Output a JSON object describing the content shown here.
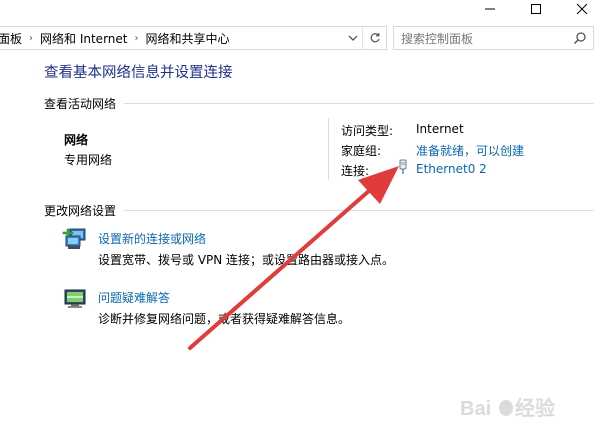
{
  "window": {
    "minimize_label": "—",
    "maximize_label": "☐",
    "close_label": "✕"
  },
  "breadcrumb": {
    "items": [
      "面板",
      "网络和 Internet",
      "网络和共享中心"
    ]
  },
  "search": {
    "placeholder": "搜索控制面板"
  },
  "main": {
    "title": "查看基本网络信息并设置连接",
    "active_networks_label": "查看活动网络",
    "network": {
      "name": "网络",
      "type": "专用网络"
    },
    "details": {
      "access_type_label": "访问类型:",
      "access_type_value": "Internet",
      "homegroup_label": "家庭组:",
      "homegroup_value": "准备就绪，可以创建",
      "connection_label": "连接:",
      "connection_value": "Ethernet0 2"
    },
    "change_settings_label": "更改网络设置",
    "tasks": [
      {
        "title": "设置新的连接或网络",
        "description": "设置宽带、拨号或 VPN 连接；或设置路由器或接入点。",
        "icon": "new-connection-icon"
      },
      {
        "title": "问题疑难解答",
        "description": "诊断并修复网络问题，或者获得疑难解答信息。",
        "icon": "troubleshoot-icon"
      }
    ]
  },
  "colors": {
    "title": "#1e3287",
    "link": "#0a67b4",
    "arrow": "#e03c3c"
  }
}
